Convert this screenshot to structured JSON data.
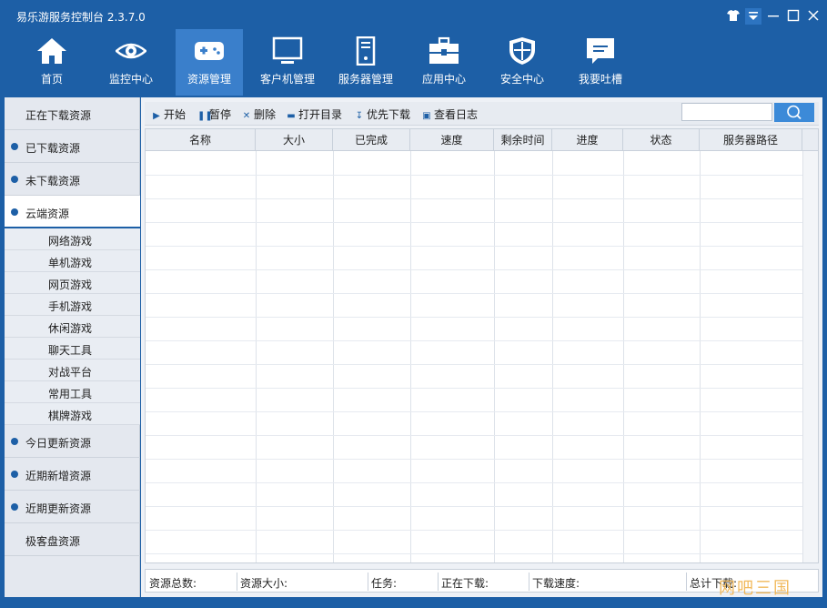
{
  "window": {
    "title": "易乐游服务控制台 2.3.7.0",
    "controls": [
      "shirt-icon",
      "menu-down-icon",
      "minimize-icon",
      "maximize-icon",
      "close-icon"
    ]
  },
  "nav": {
    "items": [
      {
        "label": "首页",
        "icon": "home-icon"
      },
      {
        "label": "监控中心",
        "icon": "eye-icon"
      },
      {
        "label": "资源管理",
        "icon": "gamepad-icon",
        "active": true
      },
      {
        "label": "客户机管理",
        "icon": "monitor-icon"
      },
      {
        "label": "服务器管理",
        "icon": "server-icon"
      },
      {
        "label": "应用中心",
        "icon": "toolbox-icon"
      },
      {
        "label": "安全中心",
        "icon": "shield-icon"
      },
      {
        "label": "我要吐槽",
        "icon": "comment-icon"
      }
    ]
  },
  "sidebar": {
    "downloading": "正在下载资源",
    "downloaded": "已下载资源",
    "not_downloaded": "未下载资源",
    "cloud": "云端资源",
    "sub": [
      "网络游戏",
      "单机游戏",
      "网页游戏",
      "手机游戏",
      "休闲游戏",
      "聊天工具",
      "对战平台",
      "常用工具",
      "棋牌游戏"
    ],
    "today": "今日更新资源",
    "recent_added": "近期新增资源",
    "recent_updated": "近期更新资源",
    "jikepan": "极客盘资源"
  },
  "toolbar": {
    "start": "开始",
    "pause": "暂停",
    "delete": "删除",
    "open_dir": "打开目录",
    "priority": "优先下载",
    "view_log": "查看日志",
    "search_value": ""
  },
  "table": {
    "columns": [
      "名称",
      "大小",
      "已完成",
      "速度",
      "剩余时间",
      "进度",
      "状态",
      "服务器路径"
    ],
    "rows": []
  },
  "status": {
    "total_count": "资源总数:",
    "total_size": "资源大小:",
    "tasks": "任务:",
    "downloading": "正在下载:",
    "speed": "下载速度:",
    "total_dl": "总计下载:"
  },
  "watermark": "网吧三国",
  "colors": {
    "brand": "#1d5fa6",
    "nav_active": "#3a7fcb",
    "search_button": "#3c8ad8"
  }
}
